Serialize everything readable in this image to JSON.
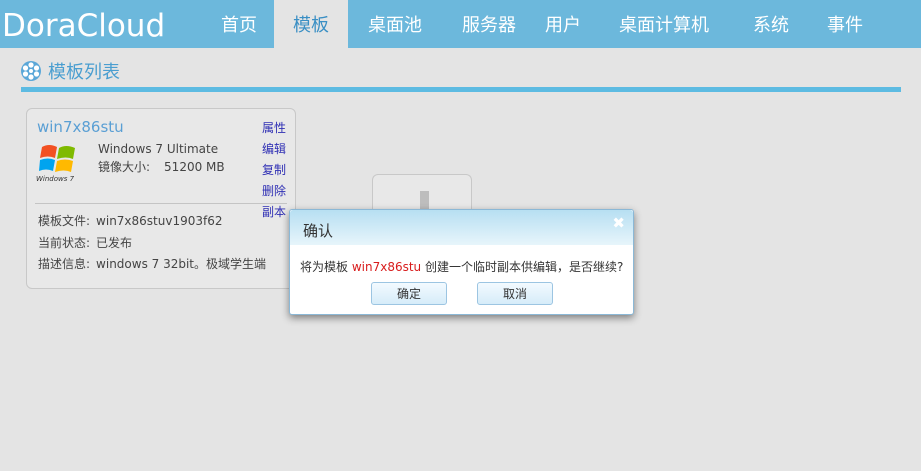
{
  "app": {
    "logo": "DoraCloud"
  },
  "nav": {
    "items": [
      {
        "label": "首页",
        "active": false
      },
      {
        "label": "模板",
        "active": true
      },
      {
        "label": "桌面池",
        "active": false
      },
      {
        "label": "服务器",
        "active": false
      },
      {
        "label": "用户",
        "active": false
      },
      {
        "label": "桌面计算机",
        "active": false
      },
      {
        "label": "系统",
        "active": false
      },
      {
        "label": "事件",
        "active": false
      }
    ]
  },
  "section": {
    "title": "模板列表",
    "icon": "film-reel-icon"
  },
  "template_card": {
    "name": "win7x86stu",
    "os_logo_caption": "Windows 7",
    "os": "Windows 7 Ultimate",
    "image_size_label": "镜像大小:",
    "image_size_value": "51200 MB",
    "actions": [
      "属性",
      "编辑",
      "复制",
      "删除",
      "副本"
    ],
    "file_label": "模板文件:",
    "file_value": "win7x86stuv1903f62",
    "status_label": "当前状态:",
    "status_value": "已发布",
    "desc_label": "描述信息:",
    "desc_value": "windows 7 32bit。极域学生端"
  },
  "dialog": {
    "title": "确认",
    "message_prefix": "将为模板 ",
    "message_highlight": "win7x86stu",
    "message_suffix": " 创建一个临时副本供编辑，是否继续?",
    "ok_label": "确定",
    "cancel_label": "取消"
  },
  "colors": {
    "nav_bg": "#6cb8dc",
    "accent_line": "#5dbbe2",
    "link": "#2f2fb4",
    "highlight": "#d81c1c"
  }
}
